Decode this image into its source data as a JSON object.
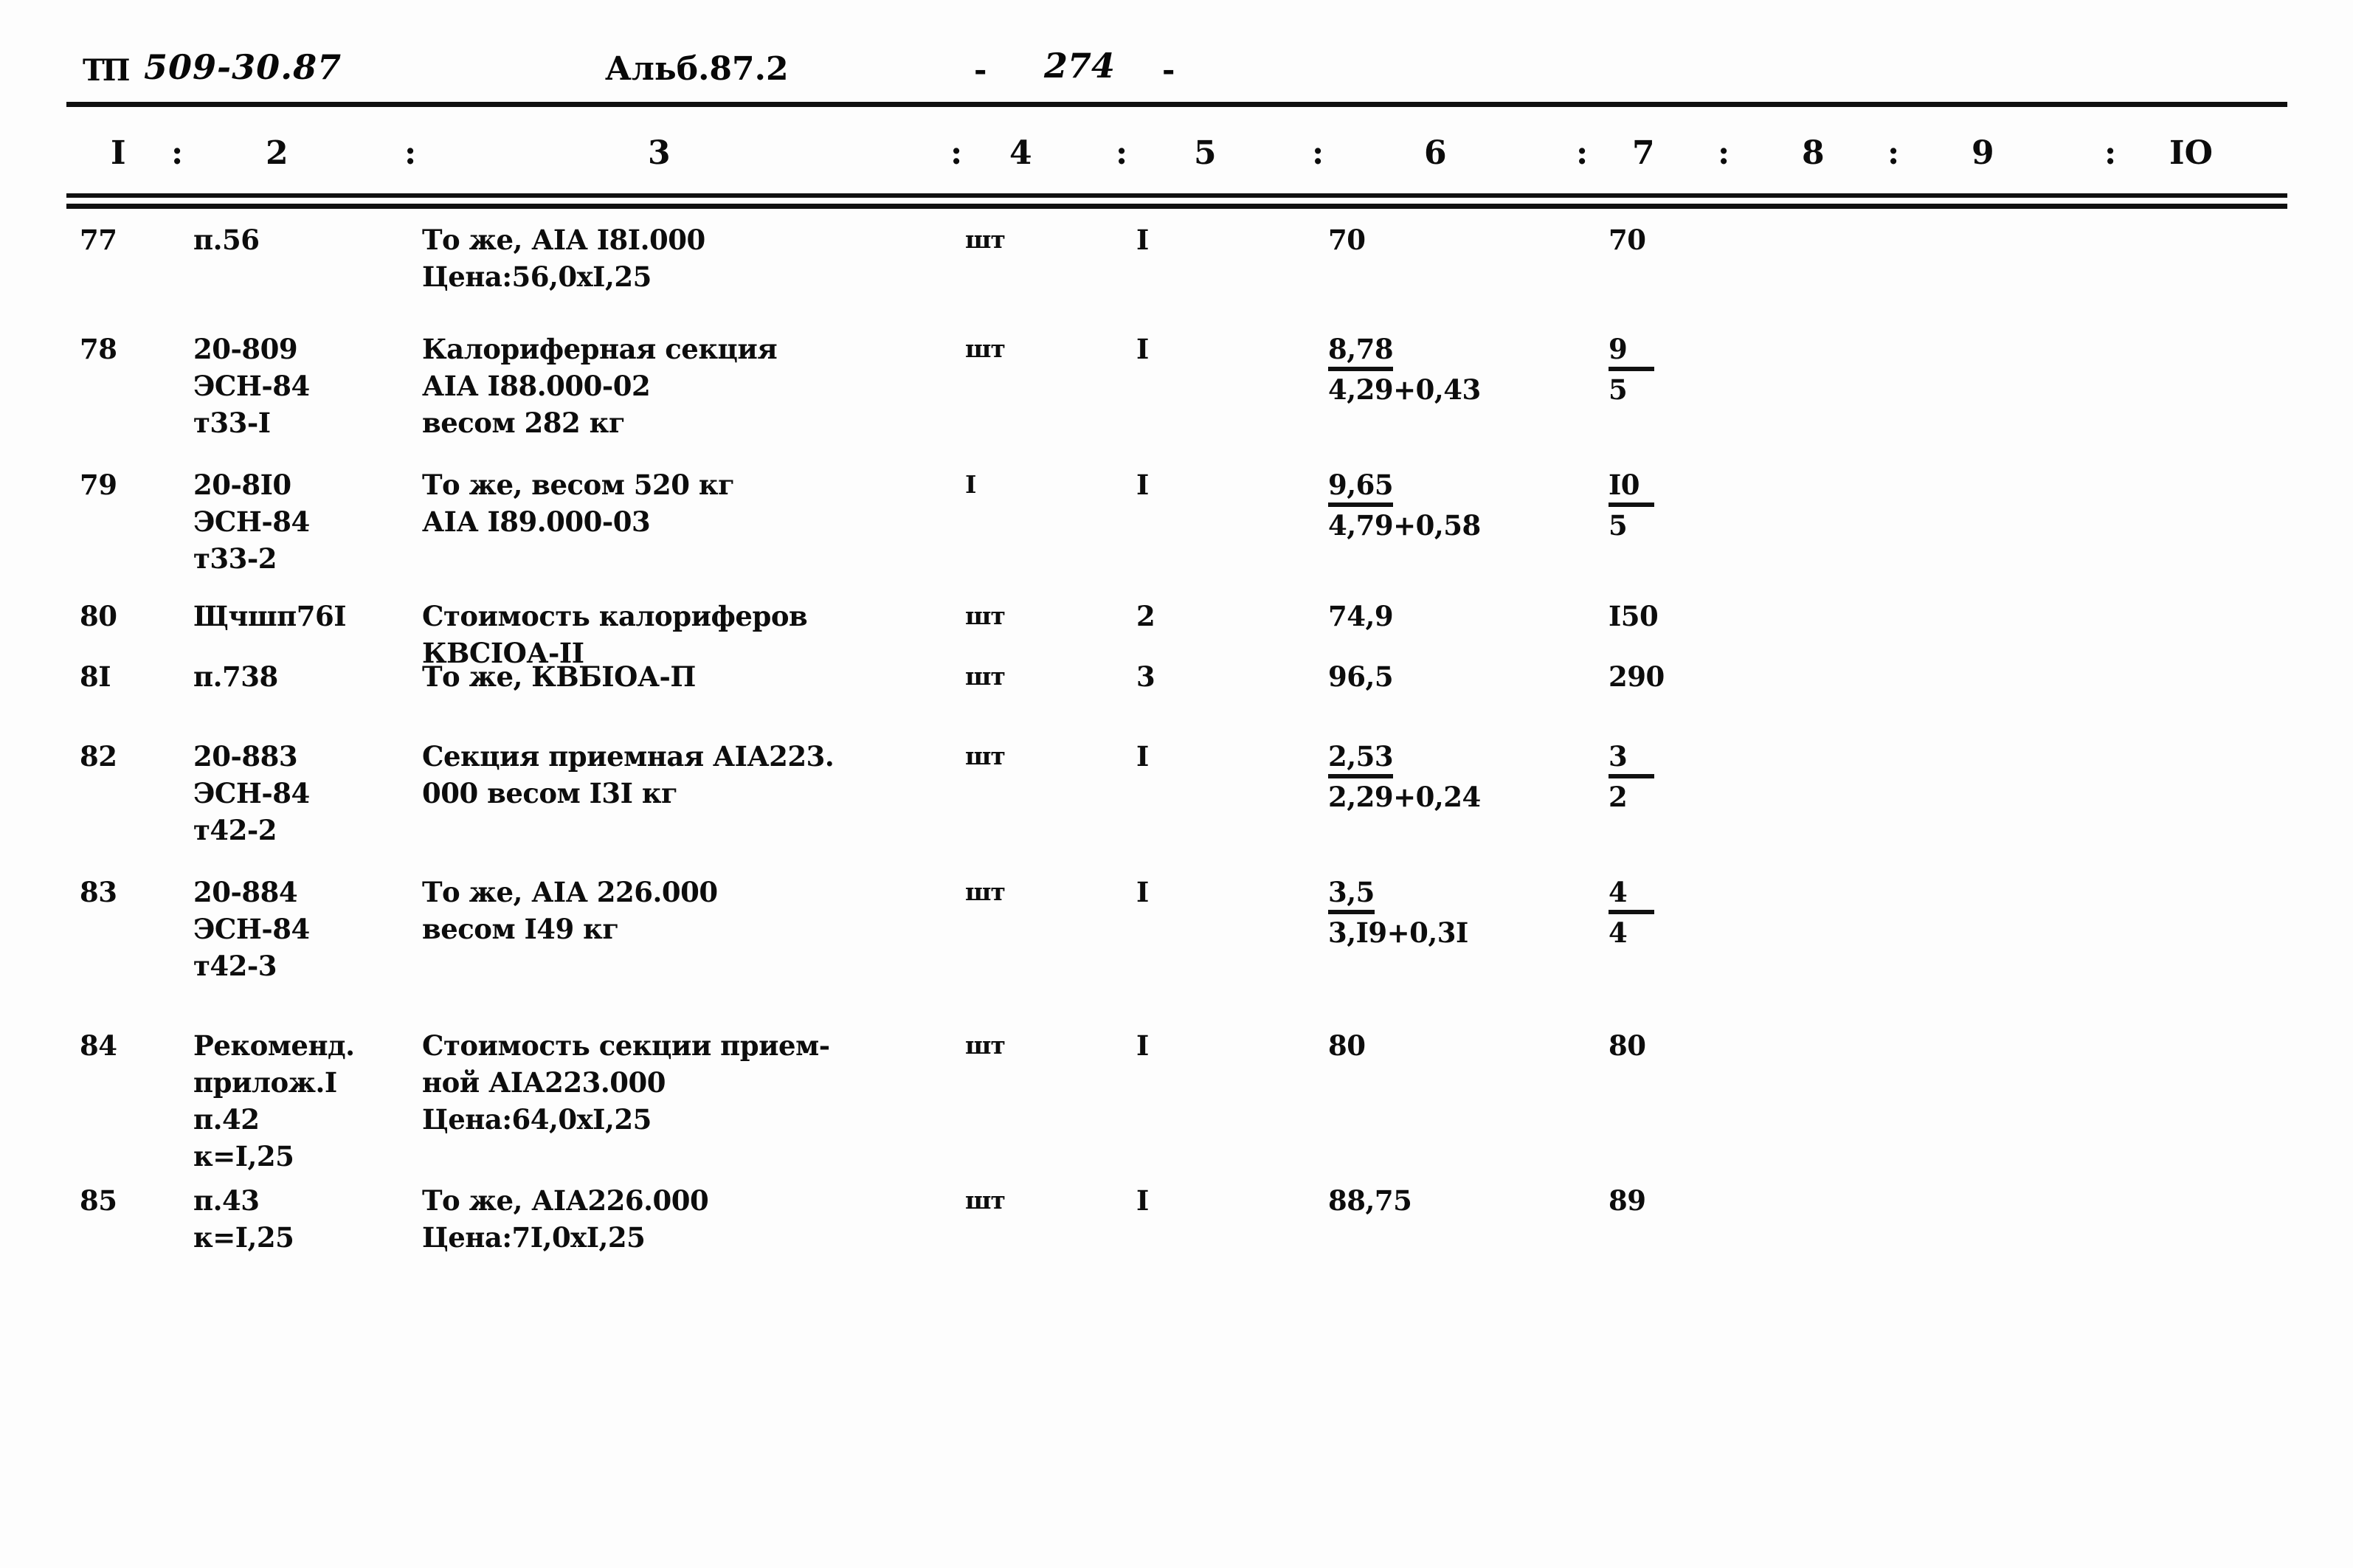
{
  "header": {
    "doc_prefix": "ТП",
    "doc_code": "509-30.87",
    "album": "Альб.87.2",
    "dash_left": "-",
    "page_number": "274",
    "dash_right": "-"
  },
  "column_headers": [
    "I",
    "2",
    "3",
    "4",
    "5",
    "6",
    "7",
    "8",
    "9",
    "IO"
  ],
  "column_separator": ":",
  "rows": [
    {
      "num": "77",
      "ref": "п.56",
      "desc": "То же, АIА I8I.000\nЦена:56,0хI,25",
      "unit": "шт",
      "qty": "I",
      "col6_top": "70",
      "col6_bot": "",
      "col7_top": "70",
      "col7_bot": "",
      "fraction": false
    },
    {
      "num": "78",
      "ref": "20-809\nЭСН-84\nт33-I",
      "desc": "Калориферная секция\nАIА I88.000-02\nвесом 282 кг",
      "unit": "шт",
      "qty": "I",
      "col6_top": "8,78",
      "col6_bot": "4,29+0,43",
      "col7_top": "9",
      "col7_bot": "5",
      "fraction": true
    },
    {
      "num": "79",
      "ref": "20-8I0\nЭСН-84\nт33-2",
      "desc": "То же, весом 520 кг\nАIА I89.000-03",
      "unit": "I",
      "qty": "I",
      "col6_top": "9,65",
      "col6_bot": "4,79+0,58",
      "col7_top": "I0",
      "col7_bot": "5",
      "fraction": true
    },
    {
      "num": "80",
      "ref": "Щчшп76I",
      "desc": "Стоимость калориферов\nКВСIОА-II",
      "unit": "шт",
      "qty": "2",
      "col6_top": "74,9",
      "col6_bot": "",
      "col7_top": "I50",
      "col7_bot": "",
      "fraction": false
    },
    {
      "num": "8I",
      "ref": "п.738",
      "desc": "То же, КВБIОА-П",
      "unit": "шт",
      "qty": "3",
      "col6_top": "96,5",
      "col6_bot": "",
      "col7_top": "290",
      "col7_bot": "",
      "fraction": false
    },
    {
      "num": "82",
      "ref": "20-883\nЭСН-84\nт42-2",
      "desc": "Секция приемная АIА223.\n000 весом I3I кг",
      "unit": "шт",
      "qty": "I",
      "col6_top": "2,53",
      "col6_bot": "2,29+0,24",
      "col7_top": "3",
      "col7_bot": "2",
      "fraction": true
    },
    {
      "num": "83",
      "ref": "20-884\nЭСН-84\nт42-3",
      "desc": "То же, АIА 226.000\nвесом I49 кг",
      "unit": "шт",
      "qty": "I",
      "col6_top": "3,5",
      "col6_bot": "3,I9+0,3I",
      "col7_top": "4",
      "col7_bot": "4",
      "fraction": true
    },
    {
      "num": "84",
      "ref": "Рекоменд.\nприлож.I\nп.42\nк=I,25",
      "desc": "Стоимость секции прием-\nной АIА223.000\nЦена:64,0хI,25",
      "unit": "шт",
      "qty": "I",
      "col6_top": "80",
      "col6_bot": "",
      "col7_top": "80",
      "col7_bot": "",
      "fraction": false
    },
    {
      "num": "85",
      "ref": "п.43\nк=I,25",
      "desc": "То же, АIА226.000\nЦена:7I,0хI,25",
      "unit": "шт",
      "qty": "I",
      "col6_top": "88,75",
      "col6_bot": "",
      "col7_top": "89",
      "col7_bot": "",
      "fraction": false
    }
  ]
}
